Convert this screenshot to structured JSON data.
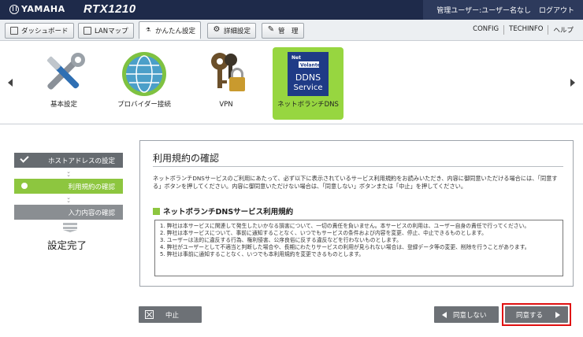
{
  "header": {
    "brand": "YAMAHA",
    "model": "RTX1210",
    "user": "管理ユーザー:ユーザー名なし",
    "logout": "ログアウト"
  },
  "tabs": [
    {
      "label": "ダッシュボード",
      "icon": "dashboard-icon"
    },
    {
      "label": "LANマップ",
      "icon": "lan-map-icon"
    },
    {
      "label": "かんたん設定",
      "icon": "wand-icon"
    },
    {
      "label": "詳細設定",
      "icon": "gear-icon"
    },
    {
      "label": "管　理",
      "icon": "wrench-icon"
    }
  ],
  "toplinks": {
    "config": "CONFIG",
    "techinfo": "TECHINFO",
    "help": "ヘルプ"
  },
  "nav": {
    "items": [
      {
        "label": "基本設定",
        "icon": "tools-icon"
      },
      {
        "label": "プロバイダー接続",
        "icon": "globe-icon"
      },
      {
        "label": "VPN",
        "icon": "keys-lock-icon"
      },
      {
        "label": "ネットボランチDNS",
        "icon": "ddns-icon",
        "badge_line1": "Net",
        "badge_line2": "Volante",
        "badge_line3": "DDNS",
        "badge_line4": "Service"
      }
    ],
    "active_color": "#97d640"
  },
  "steps": {
    "step1": "ホストアドレスの設定",
    "step2": "利用規約の確認",
    "step3": "入力内容の確認",
    "finish": "設定完了"
  },
  "panel": {
    "title": "利用規約の確認",
    "intro": "ネットボランチDNSサービスのご利用にあたって、必ず以下に表示されているサービス利用規約をお読みいただき、内容に御同意いただける場合には、「同意する」ボタンを押してください。内容に御同意いただけない場合は、「同意しない」ボタンまたは「中止」を押してください。",
    "section": "ネットボランチDNSサービス利用規約",
    "terms": [
      "1. 弊社は本サービスに関連して発生したいかなる損害について、一切の責任を負いません。本サービスの利用は、ユーザー自身の責任で行ってください。",
      "2. 弊社は本サービスについて、事前に通知することなく、いつでもサービスの条件および内容を変更、停止、中止できるものとします。",
      "3. ユーザーは法的に違反する行為、権利侵害、公序良俗に反する違反などを行わないものとします。",
      "4. 弊社がユーザーとして不適当と判断した場合や、長期にわたりサービスの利用が見られない場合は、登録データ等の変更、削除を行うことがあります。",
      "5. 弊社は事前に通知することなく、いつでも本利用規約を変更できるものとします。"
    ]
  },
  "buttons": {
    "cancel": "中止",
    "decline": "同意しない",
    "agree": "同意する"
  },
  "colors": {
    "header_bg": "#1e2a4a",
    "accent_green": "#8dc63f",
    "highlight": "#e01010"
  }
}
